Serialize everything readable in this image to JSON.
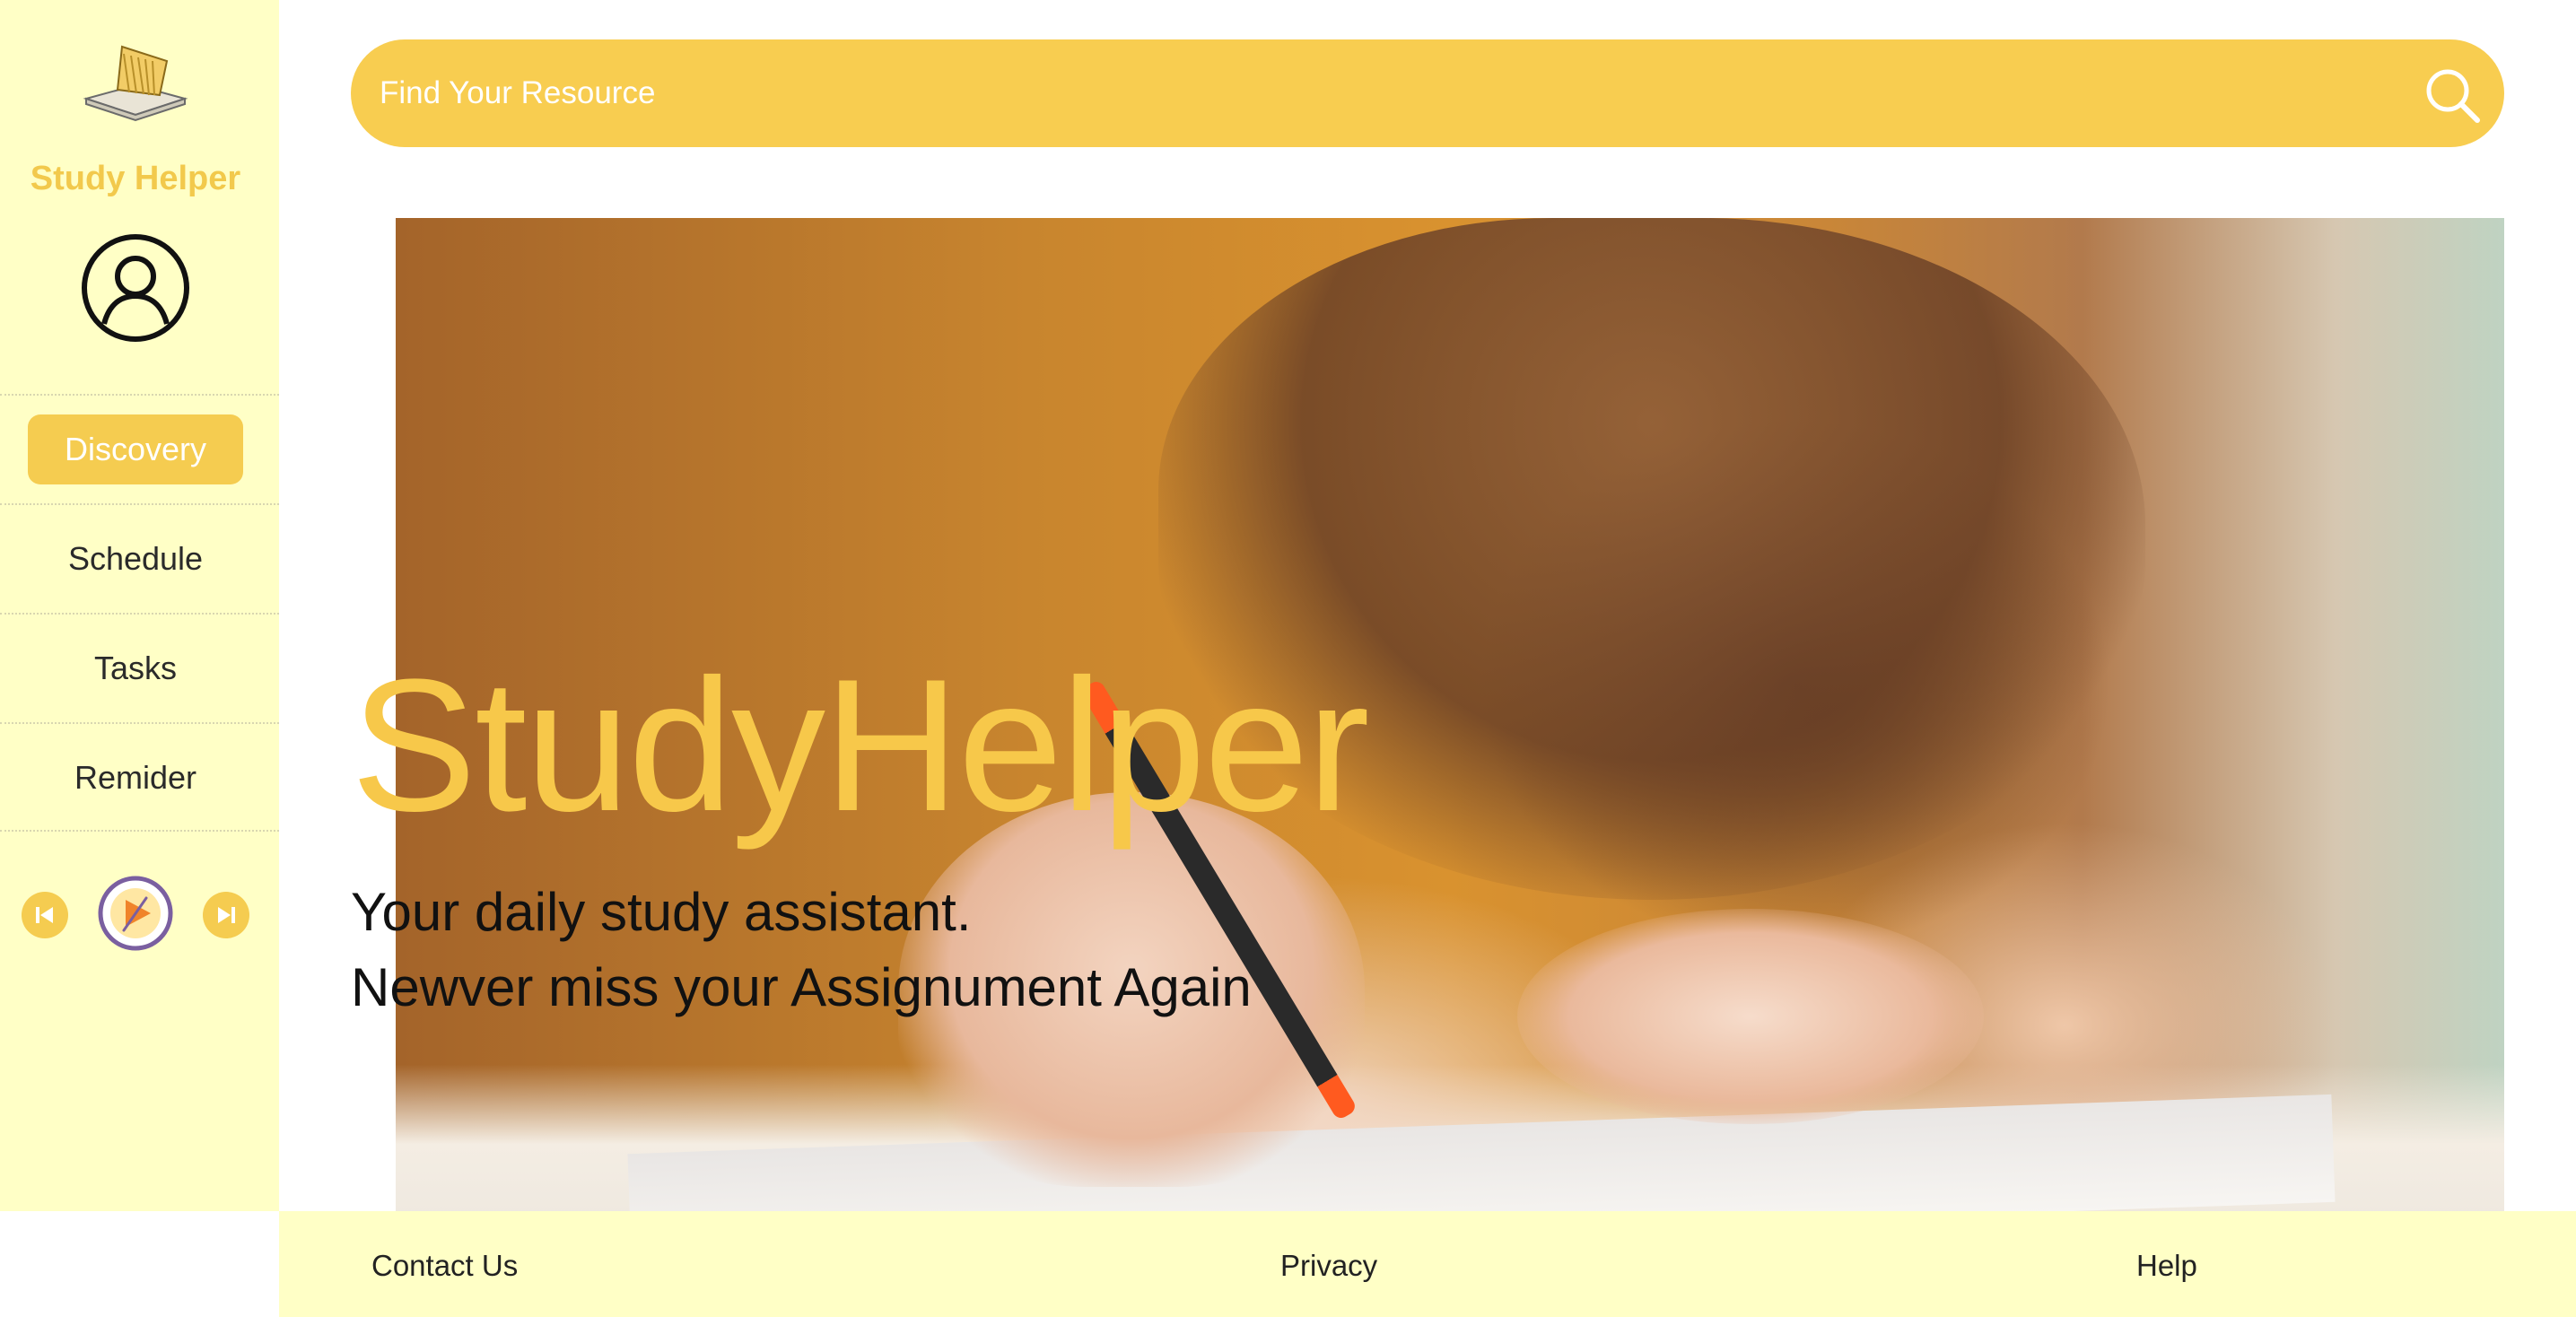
{
  "brand": {
    "name": "Study Helper"
  },
  "sidebar": {
    "items": [
      {
        "label": "Discovery",
        "active": true
      },
      {
        "label": "Schedule",
        "active": false
      },
      {
        "label": "Tasks",
        "active": false
      },
      {
        "label": "Remider",
        "active": false
      }
    ]
  },
  "player": {
    "prev_icon": "skip-back-icon",
    "play_icon": "play-icon",
    "next_icon": "skip-forward-icon"
  },
  "search": {
    "placeholder": "Find Your Resource",
    "icon": "search-icon"
  },
  "hero": {
    "title": "StudyHelper",
    "line1": "Your daily study assistant.",
    "line2": "Newver miss your Assignument Again"
  },
  "footer": {
    "links": [
      "Contact Us",
      "Privacy",
      "Help"
    ]
  },
  "colors": {
    "accent": "#f5cc50",
    "sidebar_bg": "#ffffc6",
    "title_yellow": "#f7c84a"
  }
}
